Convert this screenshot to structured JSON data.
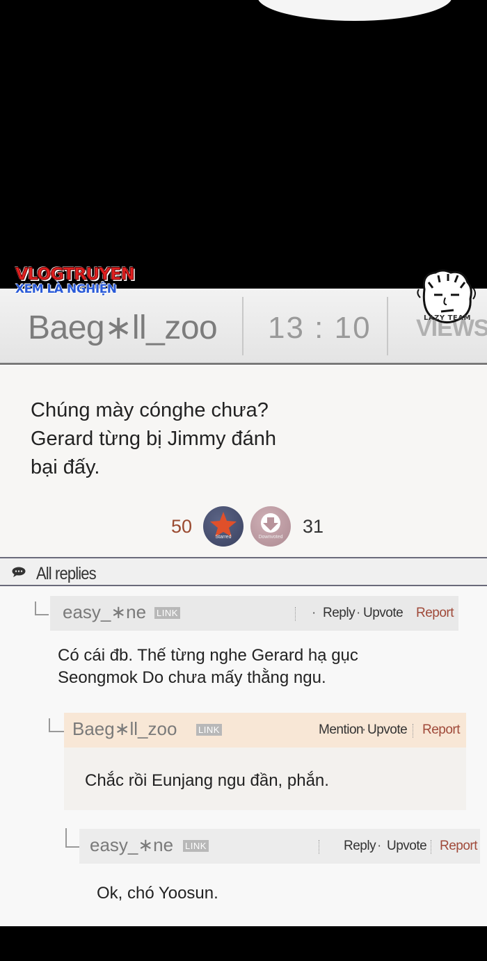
{
  "watermark": {
    "line1": "VLOGTRUYEN",
    "line2": "XEM LÀ NGHIỆN",
    "team": "LAZY TEAM"
  },
  "header": {
    "username": "Baeg∗ll_zoo",
    "time": "13 : 10",
    "views_label": "VIEWS"
  },
  "post": {
    "lines": [
      "Chúng mày cónghe chưa?",
      "Gerard từng bị Jimmy đánh",
      "bại đấy."
    ],
    "upvotes": "50",
    "downvotes": "31",
    "star_label": "Starred",
    "down_label": "Downvoted"
  },
  "replies": {
    "title": "All replies",
    "items": [
      {
        "username": "easy_∗ne",
        "link": "LINK",
        "action1": "Reply",
        "action2": "Upvote",
        "report": "Report",
        "lines": [
          "Có cái đb. Thế từng nghe Gerard hạ gục",
          "Seongmok Do chưa mấy thằng ngu."
        ]
      },
      {
        "username": "Baeg∗ll_zoo",
        "link": "LINK",
        "action1": "Mention",
        "action2": "Upvote",
        "report": "Report",
        "lines": [
          "Chắc rồi Eunjang ngu đần, phắn."
        ]
      },
      {
        "username": "easy_∗ne",
        "link": "LINK",
        "action1": "Reply",
        "action2": "Upvote",
        "report": "Report",
        "lines": [
          "Ok, chó Yoosun."
        ]
      }
    ]
  },
  "colors": {
    "report": "#a04a3a",
    "upvote_count": "#9a4a30",
    "star_button": "#3a4160",
    "down_button": "#ad8a92",
    "highlight_reply": "#f8e7d6"
  }
}
